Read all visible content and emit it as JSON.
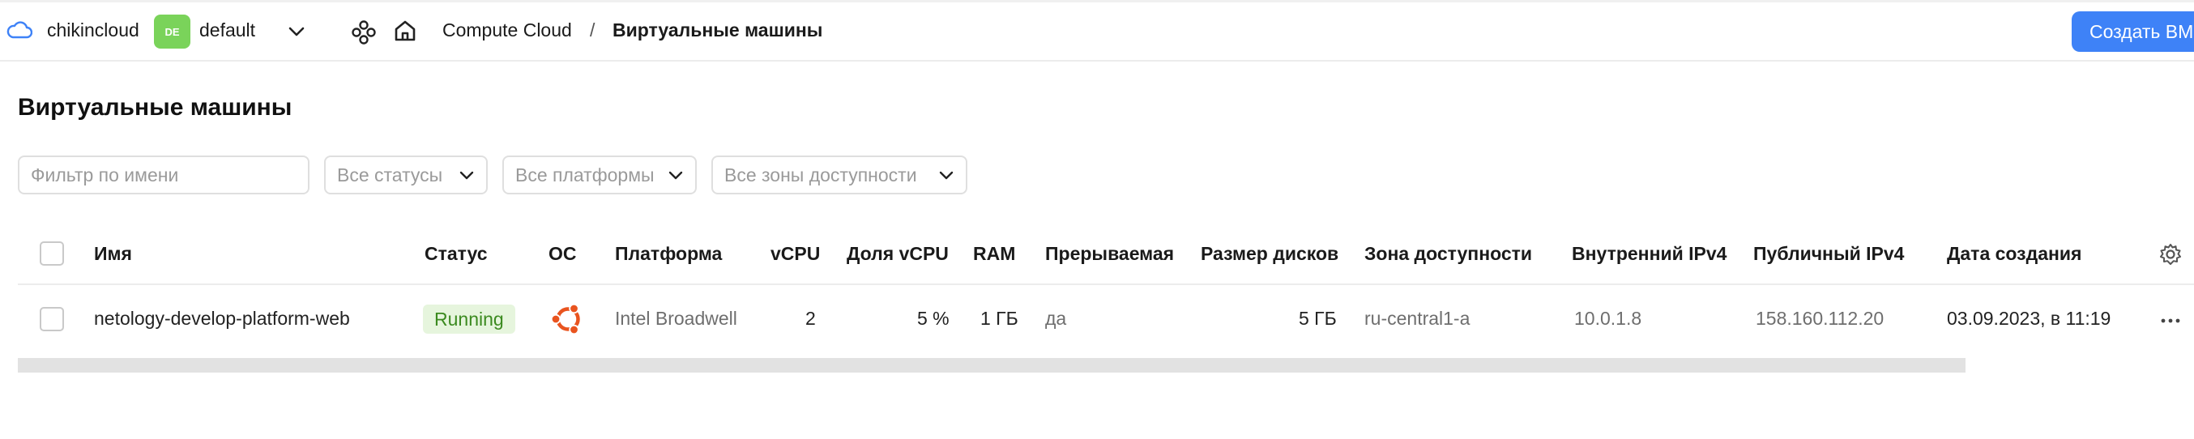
{
  "header": {
    "org_name": "chikincloud",
    "folder_badge": "DE",
    "folder_name": "default",
    "breadcrumb_service": "Compute Cloud",
    "breadcrumb_separator": "/",
    "breadcrumb_current": "Виртуальные машины",
    "create_button": "Создать ВМ",
    "accent_color": "#3e82f7",
    "folder_badge_color": "#7ad35a"
  },
  "page": {
    "title": "Виртуальные машины"
  },
  "filters": {
    "name_placeholder": "Фильтр по имени",
    "name_value": "",
    "status": "Все статусы",
    "platform": "Все платформы",
    "zone": "Все зоны доступности"
  },
  "table": {
    "columns": {
      "name": "Имя",
      "status": "Статус",
      "os": "ОС",
      "platform": "Платформа",
      "vcpu": "vCPU",
      "vcpu_share": "Доля vCPU",
      "ram": "RAM",
      "preemptible": "Прерываемая",
      "disk_size": "Размер дисков",
      "zone": "Зона доступности",
      "internal_ipv4": "Внутренний IPv4",
      "public_ipv4": "Публичный IPv4",
      "created": "Дата создания"
    },
    "rows": [
      {
        "name": "netology-develop-platform-web",
        "status": "Running",
        "os_icon": "ubuntu-icon",
        "platform": "Intel Broadwell",
        "vcpu": "2",
        "vcpu_share": "5 %",
        "ram": "1 ГБ",
        "preemptible": "да",
        "disk_size": "5 ГБ",
        "zone": "ru-central1-a",
        "internal_ipv4": "10.0.1.8",
        "public_ipv4": "158.160.112.20",
        "created": "03.09.2023, в 11:19"
      }
    ],
    "status_colors": {
      "running_bg": "#e6f5dd",
      "running_text": "#3b8a1f"
    },
    "icons": {
      "settings": "gear-icon",
      "row_actions": "more-icon",
      "os": "ubuntu-icon"
    }
  }
}
